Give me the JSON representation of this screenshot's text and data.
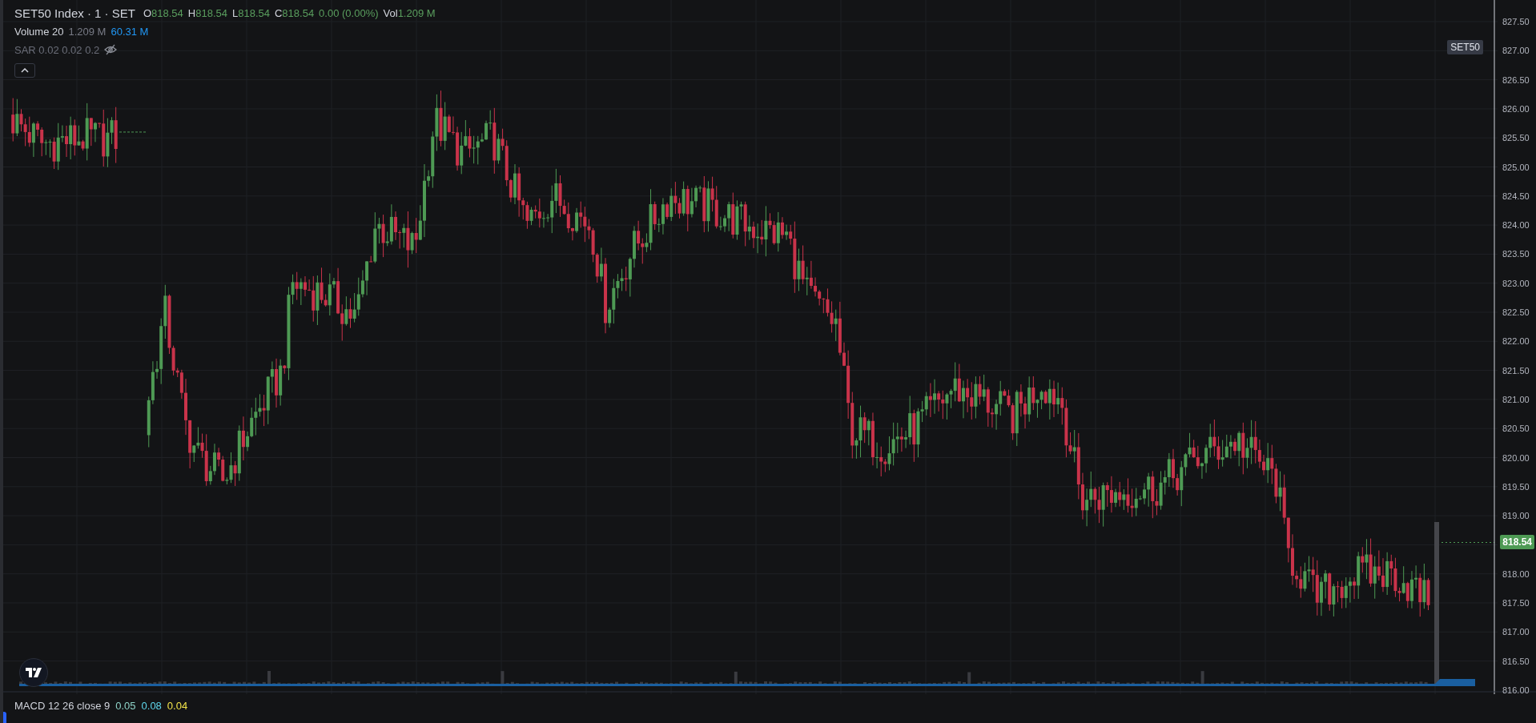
{
  "legend": {
    "symbol": "SET50 Index · 1 · SET",
    "quote": [
      {
        "label": "O",
        "value": "818.54"
      },
      {
        "label": "H",
        "value": "818.54"
      },
      {
        "label": "L",
        "value": "818.54"
      },
      {
        "label": "C",
        "value": "818.54"
      }
    ],
    "change": "0.00 (0.00%)",
    "volume_label": "Vol",
    "volume_value": "1.209 M"
  },
  "indicators": [
    {
      "name": "Volume 20",
      "hidden": false,
      "values": [
        {
          "text": "1.209 M",
          "color": "#787b86"
        },
        {
          "text": "60.31 M",
          "color": "#2196f3"
        }
      ]
    },
    {
      "name": "SAR 0.02 0.02 0.2",
      "hidden": true
    }
  ],
  "symbol_tag": "SET50",
  "price_axis": {
    "labels": [
      "827.50",
      "827.00",
      "826.50",
      "826.00",
      "825.50",
      "825.00",
      "824.50",
      "824.00",
      "823.50",
      "823.00",
      "822.50",
      "822.00",
      "821.50",
      "821.00",
      "820.50",
      "820.00",
      "819.50",
      "819.00",
      "818.00",
      "817.50",
      "817.00",
      "816.50",
      "816.00"
    ],
    "last_price": "818.54"
  },
  "macd": {
    "name": "MACD 12 26 close 9",
    "values": [
      {
        "text": "0.05",
        "color": "#8fd3c8"
      },
      {
        "text": "0.08",
        "color": "#5fd8ee"
      },
      {
        "text": "0.04",
        "color": "#f2e34a"
      }
    ]
  }
}
